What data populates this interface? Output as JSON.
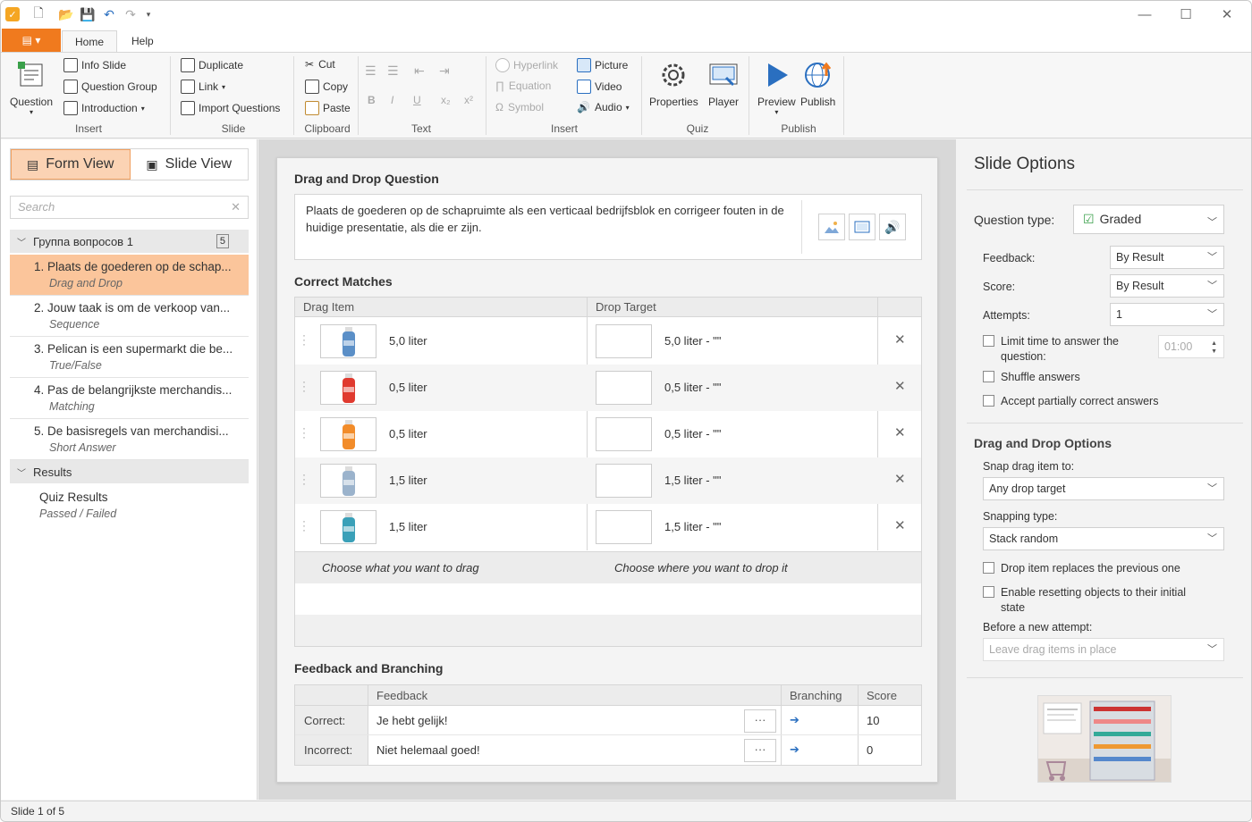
{
  "titlebar": {
    "minimize_glyph": "—",
    "maximize_glyph": "☐",
    "close_glyph": "✕"
  },
  "ribbon_tabs": [
    "Home",
    "Help"
  ],
  "ribbon": {
    "insert": {
      "question": "Question",
      "info_slide": "Info Slide",
      "question_group": "Question Group",
      "introduction": "Introduction",
      "group": "Insert"
    },
    "slide": {
      "duplicate": "Duplicate",
      "link": "Link",
      "import_questions": "Import Questions",
      "group": "Slide"
    },
    "clipboard": {
      "cut": "Cut",
      "copy": "Copy",
      "paste": "Paste",
      "group": "Clipboard"
    },
    "text": {
      "group": "Text",
      "bold": "B",
      "italic": "I",
      "underline": "U",
      "subscript": "x₂",
      "superscript": "x²"
    },
    "insert2": {
      "hyperlink": "Hyperlink",
      "equation": "Equation",
      "symbol": "Symbol",
      "picture": "Picture",
      "video": "Video",
      "audio": "Audio",
      "group": "Insert"
    },
    "quiz": {
      "properties": "Properties",
      "player": "Player",
      "group": "Quiz"
    },
    "publish": {
      "preview": "Preview",
      "publish": "Publish",
      "group": "Publish"
    }
  },
  "left": {
    "form_view": "Form View",
    "slide_view": "Slide View",
    "search_placeholder": "Search",
    "group_name": "Группа вопросов 1",
    "group_count": "5",
    "questions": [
      {
        "title": "1.  Plaats de goederen op de schap...",
        "type": "Drag and Drop"
      },
      {
        "title": "2.  Jouw taak is om de verkoop van...",
        "type": "Sequence"
      },
      {
        "title": "3.  Pelican is een supermarkt die be...",
        "type": "True/False"
      },
      {
        "title": "4.  Pas de belangrijkste merchandis...",
        "type": "Matching"
      },
      {
        "title": "5.  De basisregels van merchandisi...",
        "type": "Short Answer"
      }
    ],
    "results_label": "Results",
    "quiz_results": "Quiz Results",
    "quiz_results_sub": "Passed / Failed"
  },
  "main": {
    "question_header": "Drag and Drop Question",
    "question_text": "Plaats de goederen op de schapruimte als een verticaal bedrijfsblok en corrigeer fouten in de huidige presentatie, als die er zijn.",
    "correct_matches": "Correct Matches",
    "col_drag": "Drag Item",
    "col_drop": "Drop Target",
    "rows": [
      {
        "drag": "5,0 liter",
        "drop": "5,0 liter - \"\"",
        "color": "#5b8fc7"
      },
      {
        "drag": "0,5 liter",
        "drop": "0,5 liter - \"\"",
        "color": "#e03a2f"
      },
      {
        "drag": "0,5 liter",
        "drop": "0,5 liter - \"\"",
        "color": "#f28c2a"
      },
      {
        "drag": "1,5 liter",
        "drop": "1,5 liter - \"\"",
        "color": "#9bb3cc"
      },
      {
        "drag": "1,5 liter",
        "drop": "1,5 liter - \"\"",
        "color": "#3aa0b8"
      }
    ],
    "choose_drag": "Choose what you want to drag",
    "choose_drop": "Choose where you want to drop it",
    "feedback_header": "Feedback and Branching",
    "fb_col_feedback": "Feedback",
    "fb_col_branching": "Branching",
    "fb_col_score": "Score",
    "fb_rows": [
      {
        "label": "Correct:",
        "text": "Je hebt gelijk!",
        "score": "10"
      },
      {
        "label": "Incorrect:",
        "text": "Niet helemaal goed!",
        "score": "0"
      }
    ],
    "more_glyph": "···",
    "arrow_glyph": "➔"
  },
  "right": {
    "title": "Slide Options",
    "question_type_label": "Question type:",
    "question_type_value": "Graded",
    "feedback_label": "Feedback:",
    "feedback_value": "By Result",
    "score_label": "Score:",
    "score_value": "By Result",
    "attempts_label": "Attempts:",
    "attempts_value": "1",
    "limit_time": "Limit time to answer the",
    "limit_time2": "question:",
    "time_value": "01:00",
    "shuffle": "Shuffle answers",
    "partial": "Accept partially correct answers",
    "dd_options": "Drag and Drop Options",
    "snap_label": "Snap drag item to:",
    "snap_value": "Any drop target",
    "snapping_type_label": "Snapping type:",
    "snapping_type_value": "Stack random",
    "replaces": "Drop item replaces the previous one",
    "reset": "Enable resetting objects to their initial",
    "reset2": "state",
    "before_attempt": "Before a new attempt:",
    "before_attempt_value": "Leave drag items in place"
  },
  "status": "Slide 1 of 5",
  "colors": {
    "accent": "#f07a1e",
    "selected_bg": "#fbc59b",
    "link_blue": "#2a6fc0"
  }
}
